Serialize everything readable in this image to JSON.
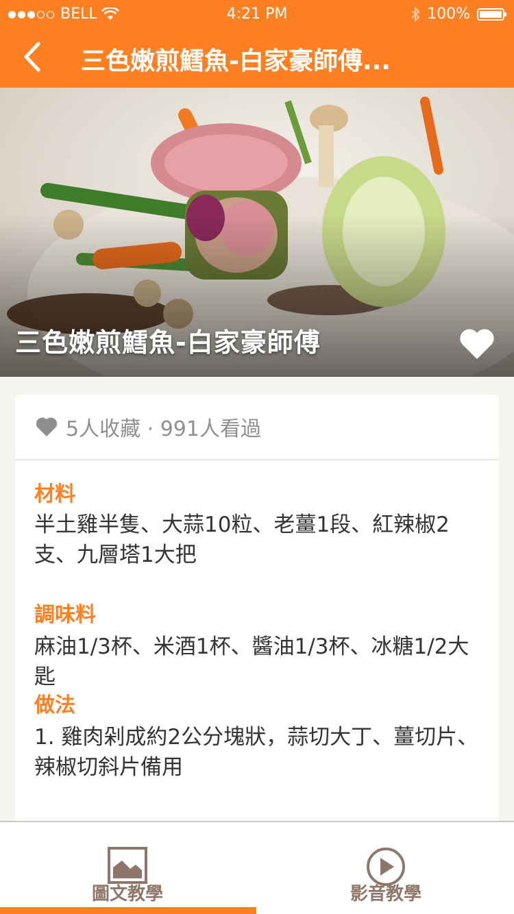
{
  "status_bar": {
    "carrier": "BELL",
    "time": "4:21 PM",
    "battery": "100%"
  },
  "nav": {
    "title": "三色嫩煎鱈魚-白家豪師傅..."
  },
  "hero": {
    "dish_name": "三色嫩煎鱈魚-白家豪師傅"
  },
  "stats": {
    "text": "5人收藏 · 991人看過"
  },
  "ingredients": {
    "title": "材料",
    "body": "半土雞半隻、大蒜10粒、老薑1段、紅辣椒2支、九層塔1大把"
  },
  "seasoning": {
    "title": "調味料",
    "body": "麻油1/3杯、米酒1杯、醬油1/3杯、冰糖1/2大匙"
  },
  "method": {
    "title": "做法",
    "body": "1.  雞肉剁成約2公分塊狀，蒜切大丁、薑切片、辣椒切斜片備用"
  },
  "tabs": {
    "pic_label": "圖文教學",
    "video_label": "影音教學"
  },
  "colors": {
    "brand": "#ff8022",
    "background": "#f6f4ef",
    "stat_text": "#8f8f8f",
    "divider": "#e5e5e5",
    "body_text": "#333333",
    "tab_text": "#8f766a",
    "tab_border": "#cbc8c1"
  }
}
